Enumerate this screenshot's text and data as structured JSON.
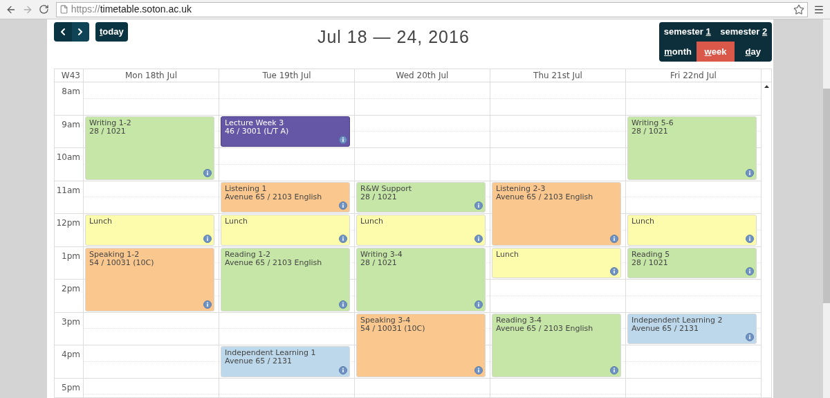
{
  "browser": {
    "url_scheme": "https://",
    "url_host": "timetable.soton.ac.uk"
  },
  "toolbar": {
    "today": "today",
    "title": "Jul 18 — 24, 2016",
    "semesters": [
      {
        "label": "semester 1",
        "selected": false
      },
      {
        "label": "semester 2",
        "selected": false
      }
    ],
    "views": [
      {
        "label": "month",
        "selected": false
      },
      {
        "label": "week",
        "selected": true
      },
      {
        "label": "day",
        "selected": false
      }
    ]
  },
  "calendar": {
    "week": "W43",
    "days": [
      "Mon 18th Jul",
      "Tue 19th Jul",
      "Wed 20th Jul",
      "Thu 21st Jul",
      "Fri 22nd Jul"
    ],
    "times": [
      "8am",
      "9am",
      "10am",
      "11am",
      "12pm",
      "1pm",
      "2pm",
      "3pm",
      "4pm",
      "5pm"
    ],
    "columns": [
      {
        "slots": [
          {
            "kind": "empty"
          },
          {
            "kind": "event",
            "title": "Writing 1-2",
            "place": "28 / 1021",
            "color": "#c5e6a6"
          },
          {
            "kind": "continued"
          },
          {
            "kind": "empty"
          },
          {
            "kind": "event",
            "title": "Lunch",
            "color": "#fdfcad"
          },
          {
            "kind": "event",
            "title": "Speaking 1-2",
            "place": "54 / 10031 (10C)",
            "color": "#fac88f"
          },
          {
            "kind": "continued"
          }
        ]
      },
      {
        "slots": [
          {
            "kind": "empty"
          },
          {
            "kind": "event",
            "title": "Lecture Week 3",
            "place": "46 / 3001 (L/T A)",
            "color": "#6656a6"
          },
          {
            "kind": "empty"
          },
          {
            "kind": "event",
            "title": "Listening 1",
            "place": "Avenue 65 / 2103 English",
            "color": "#fac88f"
          },
          {
            "kind": "event",
            "title": "Lunch",
            "color": "#fdfcad"
          },
          {
            "kind": "event",
            "title": "Reading 1-2",
            "place": "Avenue 65 / 2103 English",
            "color": "#c5e6a6"
          },
          {
            "kind": "continued"
          },
          {
            "kind": "empty"
          },
          {
            "kind": "event",
            "title": "Independent Learning 1",
            "place": "Avenue 65 / 2131",
            "color": "#bcd8ea"
          }
        ]
      },
      {
        "slots": [
          {
            "kind": "empty"
          },
          {
            "kind": "empty"
          },
          {
            "kind": "empty"
          },
          {
            "kind": "event",
            "title": "R&W Support",
            "place": "28 / 1021",
            "color": "#c5e6a6"
          },
          {
            "kind": "event",
            "title": "Lunch",
            "color": "#fdfcad"
          },
          {
            "kind": "event",
            "title": "Writing 3-4",
            "place": "28 / 1021",
            "color": "#c5e6a6"
          },
          {
            "kind": "continued"
          },
          {
            "kind": "event",
            "title": "Speaking 3-4",
            "place": "54 / 10031 (10C)",
            "color": "#fac88f"
          },
          {
            "kind": "continued"
          }
        ]
      },
      {
        "slots": [
          {
            "kind": "empty"
          },
          {
            "kind": "empty"
          },
          {
            "kind": "empty"
          },
          {
            "kind": "event",
            "title": "Listening 2-3",
            "place": "Avenue 65 / 2103 English",
            "color": "#fac88f"
          },
          {
            "kind": "continued"
          },
          {
            "kind": "event",
            "title": "Lunch",
            "color": "#fdfcad"
          },
          {
            "kind": "empty"
          },
          {
            "kind": "event",
            "title": "Reading 3-4",
            "place": "Avenue 65 / 2103 English",
            "color": "#c5e6a6"
          },
          {
            "kind": "continued"
          }
        ]
      },
      {
        "slots": [
          {
            "kind": "empty"
          },
          {
            "kind": "event",
            "title": "Writing 5-6",
            "place": "28 / 1021",
            "color": "#c5e6a6"
          },
          {
            "kind": "continued"
          },
          {
            "kind": "empty"
          },
          {
            "kind": "event",
            "title": "Lunch",
            "color": "#fdfcad"
          },
          {
            "kind": "event",
            "title": "Reading 5",
            "place": "28 / 1021",
            "color": "#c5e6a6"
          },
          {
            "kind": "empty"
          },
          {
            "kind": "event",
            "title": "Independent Learning 2",
            "place": "Avenue 65 / 2131",
            "color": "#bcd8ea"
          }
        ]
      }
    ]
  }
}
